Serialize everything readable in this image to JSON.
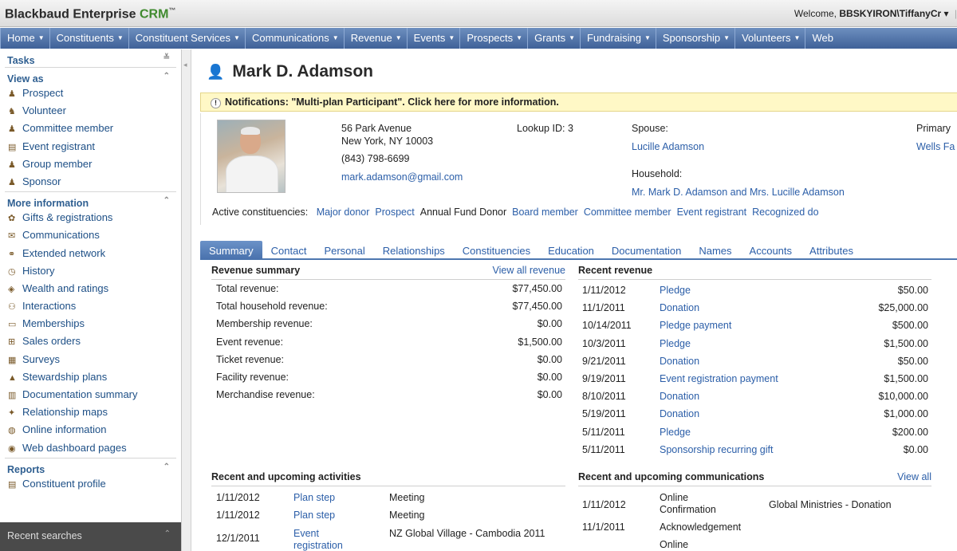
{
  "app": {
    "brand_main": "Blackbaud Enterprise ",
    "brand_crm": "CRM",
    "brand_tm": "™",
    "welcome_prefix": "Welcome, ",
    "welcome_user": "BBSKYIRON\\TiffanyCr",
    "welcome_caret": "▾"
  },
  "nav": [
    "Home",
    "Constituents",
    "Constituent Services",
    "Communications",
    "Revenue",
    "Events",
    "Prospects",
    "Grants",
    "Fundraising",
    "Sponsorship",
    "Volunteers",
    "Web"
  ],
  "sidebar": {
    "tasks_label": "Tasks",
    "view_as_label": "View as",
    "view_as": [
      {
        "label": "Prospect",
        "icon": "person-icon"
      },
      {
        "label": "Volunteer",
        "icon": "volunteer-icon"
      },
      {
        "label": "Committee member",
        "icon": "person-icon"
      },
      {
        "label": "Event registrant",
        "icon": "ticket-icon"
      },
      {
        "label": "Group member",
        "icon": "person-icon"
      },
      {
        "label": "Sponsor",
        "icon": "person-icon"
      }
    ],
    "more_info_label": "More information",
    "more_info": [
      {
        "label": "Gifts & registrations",
        "icon": "gift-icon"
      },
      {
        "label": "Communications",
        "icon": "envelope-icon"
      },
      {
        "label": "Extended network",
        "icon": "network-icon"
      },
      {
        "label": "History",
        "icon": "clock-icon"
      },
      {
        "label": "Wealth and ratings",
        "icon": "chart-icon"
      },
      {
        "label": "Interactions",
        "icon": "people-icon"
      },
      {
        "label": "Memberships",
        "icon": "card-icon"
      },
      {
        "label": "Sales orders",
        "icon": "cart-icon"
      },
      {
        "label": "Surveys",
        "icon": "clipboard-icon"
      },
      {
        "label": "Stewardship plans",
        "icon": "triangle-icon"
      },
      {
        "label": "Documentation summary",
        "icon": "document-icon"
      },
      {
        "label": "Relationship maps",
        "icon": "map-icon"
      },
      {
        "label": "Online information",
        "icon": "globe-icon"
      },
      {
        "label": "Web dashboard pages",
        "icon": "dashboard-icon"
      }
    ],
    "reports_label": "Reports",
    "reports": [
      {
        "label": "Constituent profile",
        "icon": "report-icon"
      }
    ],
    "recent_searches_label": "Recent searches"
  },
  "constituent": {
    "name": "Mark D. Adamson",
    "notification": "Notifications: \"Multi-plan Participant\". Click here for more information.",
    "address1": "56 Park Avenue",
    "address2": "New York, NY 10003",
    "phone": "(843) 798-6699",
    "email": "mark.adamson@gmail.com",
    "lookup_label": "Lookup ID:",
    "lookup_id": "3",
    "spouse_label": "Spouse:",
    "spouse": "Lucille Adamson",
    "household_label": "Household:",
    "household": "Mr. Mark D. Adamson and Mrs. Lucille Adamson",
    "primary_label": "Primary",
    "primary_value": "Wells Fa",
    "active_label": "Active constituencies:",
    "constituencies": [
      "Major donor",
      "Prospect",
      "Annual Fund Donor",
      "Board member",
      "Committee member",
      "Event registrant",
      "Recognized do"
    ]
  },
  "tabs": [
    "Summary",
    "Contact",
    "Personal",
    "Relationships",
    "Constituencies",
    "Education",
    "Documentation",
    "Names",
    "Accounts",
    "Attributes"
  ],
  "revenue_summary": {
    "title": "Revenue summary",
    "view_all": "View all revenue",
    "rows": [
      {
        "label": "Total revenue:",
        "value": "$77,450.00"
      },
      {
        "label": "Total household revenue:",
        "value": "$77,450.00"
      },
      {
        "label": "Membership revenue:",
        "value": "$0.00"
      },
      {
        "label": "Event revenue:",
        "value": "$1,500.00"
      },
      {
        "label": "Ticket revenue:",
        "value": "$0.00"
      },
      {
        "label": "Facility revenue:",
        "value": "$0.00"
      },
      {
        "label": "Merchandise revenue:",
        "value": "$0.00"
      }
    ]
  },
  "recent_revenue": {
    "title": "Recent revenue",
    "rows": [
      {
        "date": "1/11/2012",
        "type": "Pledge",
        "amount": "$50.00"
      },
      {
        "date": "11/1/2011",
        "type": "Donation",
        "amount": "$25,000.00"
      },
      {
        "date": "10/14/2011",
        "type": "Pledge payment",
        "amount": "$500.00"
      },
      {
        "date": "10/3/2011",
        "type": "Pledge",
        "amount": "$1,500.00"
      },
      {
        "date": "9/21/2011",
        "type": "Donation",
        "amount": "$50.00"
      },
      {
        "date": "9/19/2011",
        "type": "Event registration payment",
        "amount": "$1,500.00"
      },
      {
        "date": "8/10/2011",
        "type": "Donation",
        "amount": "$10,000.00"
      },
      {
        "date": "5/19/2011",
        "type": "Donation",
        "amount": "$1,000.00"
      },
      {
        "date": "5/11/2011",
        "type": "Pledge",
        "amount": "$200.00"
      },
      {
        "date": "5/11/2011",
        "type": "Sponsorship recurring gift",
        "amount": "$0.00"
      }
    ]
  },
  "activities": {
    "title": "Recent and upcoming activities",
    "rows": [
      {
        "date": "1/11/2012",
        "type": "Plan step",
        "desc": "Meeting"
      },
      {
        "date": "1/11/2012",
        "type": "Plan step",
        "desc": "Meeting"
      },
      {
        "date": "12/1/2011",
        "type": "Event registration",
        "desc": "NZ Global Village - Cambodia 2011"
      }
    ]
  },
  "communications": {
    "title": "Recent and upcoming communications",
    "view_all": "View all",
    "rows": [
      {
        "date": "1/11/2012",
        "type": "Online Confirmation",
        "desc": "Global Ministries - Donation"
      },
      {
        "date": "11/1/2011",
        "type": "Acknowledgement",
        "desc": ""
      },
      {
        "date": "",
        "type": "Online",
        "desc": ""
      }
    ]
  }
}
